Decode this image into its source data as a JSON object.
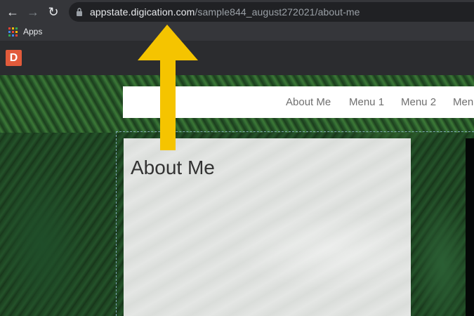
{
  "browser": {
    "url_host": "appstate.digication.com",
    "url_path": "/sample844_august272021/about-me",
    "bookmarks": {
      "apps_label": "Apps"
    }
  },
  "app": {
    "logo_letter": "D"
  },
  "site": {
    "nav": [
      "About Me",
      "Menu 1",
      "Menu 2",
      "Men"
    ],
    "content_title": "About Me"
  },
  "colors": {
    "arrow": "#f5c400",
    "logo": "#e25b3b"
  }
}
